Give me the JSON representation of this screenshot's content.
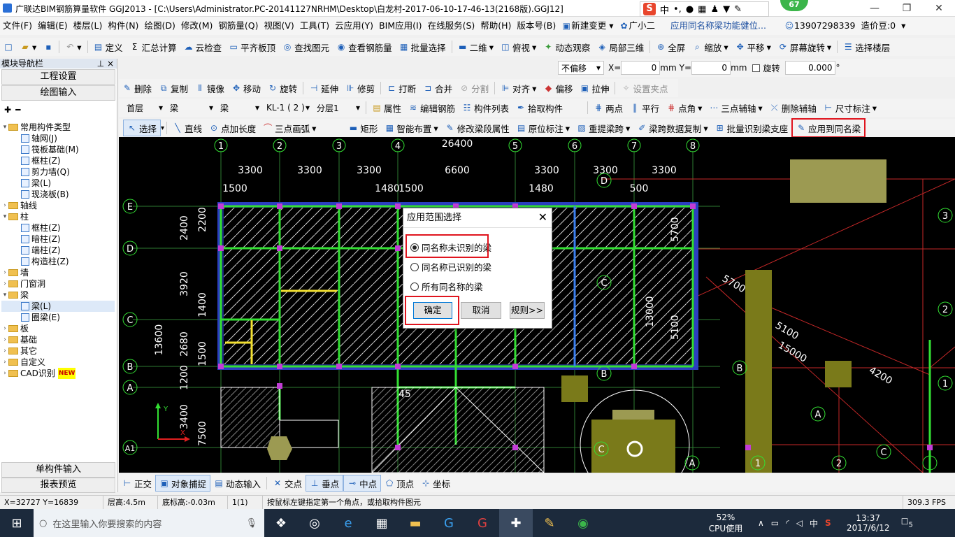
{
  "titlebar": {
    "title": "广联达BIM钢筋算量软件 GGJ2013 - [C:\\Users\\Administrator.PC-20141127NRHM\\Desktop\\白龙村-2017-06-10-17-46-13(2168版).GGJ12]",
    "ime": {
      "lang": "中",
      "extra": "•,"
    },
    "badge": "67"
  },
  "menubar": {
    "items": [
      "文件(F)",
      "编辑(E)",
      "楼层(L)",
      "构件(N)",
      "绘图(D)",
      "修改(M)",
      "钢筋量(Q)",
      "视图(V)",
      "工具(T)",
      "云应用(Y)",
      "BIM应用(I)",
      "在线服务(S)",
      "帮助(H)",
      "版本号(B)",
      "新建变更",
      "广小二",
      "应用同名称梁功能健位...",
      "13907298339",
      "造价豆:0"
    ]
  },
  "toolbar1": {
    "items": [
      "定义",
      "汇总计算",
      "云检查",
      "平齐板顶",
      "查找图元",
      "查看钢筋量",
      "批量选择",
      "二维",
      "俯视",
      "动态观察",
      "局部三维",
      "全屏",
      "缩放",
      "平移",
      "屏幕旋转",
      "选择楼层"
    ]
  },
  "toolbar_offset": {
    "mode": "不偏移",
    "x_label": "X=",
    "x_value": "0",
    "unit1": "mm",
    "y_label": "Y=",
    "y_value": "0",
    "unit2": "mm",
    "rotate_label": "旋转",
    "rotate_value": "0.000",
    "deg": "°"
  },
  "toolbar_edit": {
    "items": [
      "删除",
      "复制",
      "镜像",
      "移动",
      "旋转",
      "延伸",
      "修剪",
      "打断",
      "合并",
      "分割",
      "对齐",
      "偏移",
      "拉伸",
      "设置夹点"
    ]
  },
  "toolbar_floor": {
    "floor": "首层",
    "type": "梁",
    "subtype": "梁",
    "comp": "KL-1 ( 2 )",
    "layer": "分层1",
    "items": [
      "属性",
      "编辑钢筋",
      "构件列表",
      "拾取构件"
    ],
    "axis_items": [
      "两点",
      "平行",
      "点角",
      "三点辅轴",
      "删除辅轴",
      "尺寸标注"
    ]
  },
  "toolbar_draw": {
    "items": [
      "选择",
      "直线",
      "点加长度",
      "三点画弧",
      "矩形",
      "智能布置",
      "修改梁段属性",
      "原位标注",
      "重提梁跨",
      "梁跨数据复制",
      "批量识别梁支座",
      "应用到同名梁"
    ]
  },
  "leftpanel": {
    "title": "模块导航栏",
    "pin": "⊥ ×",
    "btn_project": "工程设置",
    "btn_draw": "绘图输入",
    "btn_single": "单构件输入",
    "btn_report": "报表预览",
    "tree": [
      {
        "label": "常用构件类型",
        "level": 0,
        "kind": "folder",
        "open": true
      },
      {
        "label": "轴网(J)",
        "level": 1,
        "kind": "leaf"
      },
      {
        "label": "筏板基础(M)",
        "level": 1,
        "kind": "leaf"
      },
      {
        "label": "框柱(Z)",
        "level": 1,
        "kind": "leaf"
      },
      {
        "label": "剪力墙(Q)",
        "level": 1,
        "kind": "leaf"
      },
      {
        "label": "梁(L)",
        "level": 1,
        "kind": "leaf"
      },
      {
        "label": "现浇板(B)",
        "level": 1,
        "kind": "leaf"
      },
      {
        "label": "轴线",
        "level": 0,
        "kind": "folder",
        "open": false
      },
      {
        "label": "柱",
        "level": 0,
        "kind": "folder",
        "open": true
      },
      {
        "label": "框柱(Z)",
        "level": 1,
        "kind": "leaf"
      },
      {
        "label": "暗柱(Z)",
        "level": 1,
        "kind": "leaf"
      },
      {
        "label": "端柱(Z)",
        "level": 1,
        "kind": "leaf"
      },
      {
        "label": "构造柱(Z)",
        "level": 1,
        "kind": "leaf"
      },
      {
        "label": "墙",
        "level": 0,
        "kind": "folder",
        "open": false
      },
      {
        "label": "门窗洞",
        "level": 0,
        "kind": "folder",
        "open": false
      },
      {
        "label": "梁",
        "level": 0,
        "kind": "folder",
        "open": true
      },
      {
        "label": "梁(L)",
        "level": 1,
        "kind": "leaf",
        "selected": true
      },
      {
        "label": "圈梁(E)",
        "level": 1,
        "kind": "leaf"
      },
      {
        "label": "板",
        "level": 0,
        "kind": "folder",
        "open": false
      },
      {
        "label": "基础",
        "level": 0,
        "kind": "folder",
        "open": false
      },
      {
        "label": "其它",
        "level": 0,
        "kind": "folder",
        "open": false
      },
      {
        "label": "自定义",
        "level": 0,
        "kind": "folder",
        "open": false
      },
      {
        "label": "CAD识别",
        "level": 0,
        "kind": "folder",
        "open": false,
        "badge": "NEW"
      }
    ]
  },
  "drawing": {
    "top_axes": [
      "1",
      "2",
      "3",
      "4",
      "5",
      "6",
      "7",
      "8"
    ],
    "top_total": "26400",
    "top_dims": [
      "3300",
      "3300",
      "3300",
      "6600",
      "3300",
      "3300",
      "3300"
    ],
    "sub_dims": [
      "1500",
      "1480",
      "1500",
      "1480",
      "500"
    ],
    "left_axes": [
      "E",
      "D",
      "C",
      "B",
      "A",
      "A1"
    ],
    "left_total": "13600",
    "left_dims": [
      "2400",
      "2200",
      "3920",
      "1400",
      "2680",
      "1500",
      "1200",
      "3400",
      "7500"
    ],
    "right_labels": [
      "5700",
      "5100",
      "15000",
      "4200",
      "3",
      "2",
      "1",
      "D",
      "C",
      "B",
      "A",
      "B",
      "C",
      "A",
      "1",
      "2",
      "3",
      "5100",
      "13000",
      "5700"
    ],
    "misc": [
      "45"
    ]
  },
  "dialog": {
    "title": "应用范围选择",
    "options": [
      "同名称未识别的梁",
      "同名称已识别的梁",
      "所有同名称的梁"
    ],
    "selected": 0,
    "ok": "确定",
    "cancel": "取消",
    "rules": "规则>>"
  },
  "snapbar": {
    "items": [
      "正交",
      "对象捕捉",
      "动态输入",
      "交点",
      "垂点",
      "中点",
      "顶点",
      "坐标"
    ]
  },
  "statusbar": {
    "coords": "X=32727 Y=16839",
    "floor_height": "层高:4.5m",
    "base_height": "底标高:-0.03m",
    "count": "1(1)",
    "hint": "按鼠标左键指定第一个角点，或拾取构件图元",
    "fps": "309.3 FPS"
  },
  "taskbar": {
    "search_placeholder": "在这里输入你要搜索的内容",
    "cpu": "52%",
    "cpu_label": "CPU使用",
    "ime": "中",
    "time": "13:37",
    "date": "2017/6/12",
    "notif": "5"
  }
}
